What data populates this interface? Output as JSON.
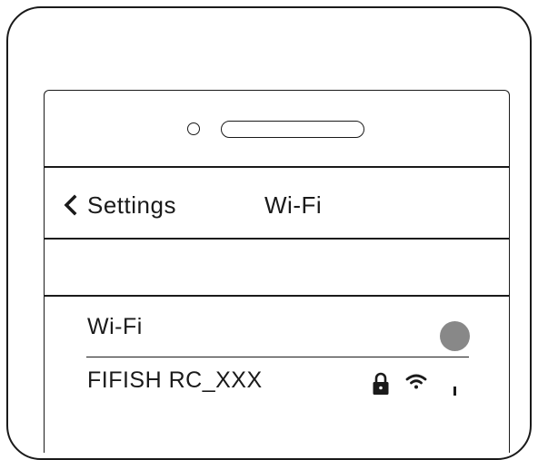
{
  "nav": {
    "back_label": "Settings",
    "title": "Wi-Fi"
  },
  "wifi_section": {
    "toggle_label": "Wi-Fi",
    "toggle_state": "on"
  },
  "networks": [
    {
      "name": "FIFISH RC_XXX",
      "secured": true,
      "icons": [
        "lock-icon",
        "wifi-signal-icon",
        "info-mark"
      ]
    }
  ],
  "colors": {
    "line": "#1a1a1a",
    "toggle": "#888888",
    "background": "#ffffff"
  }
}
